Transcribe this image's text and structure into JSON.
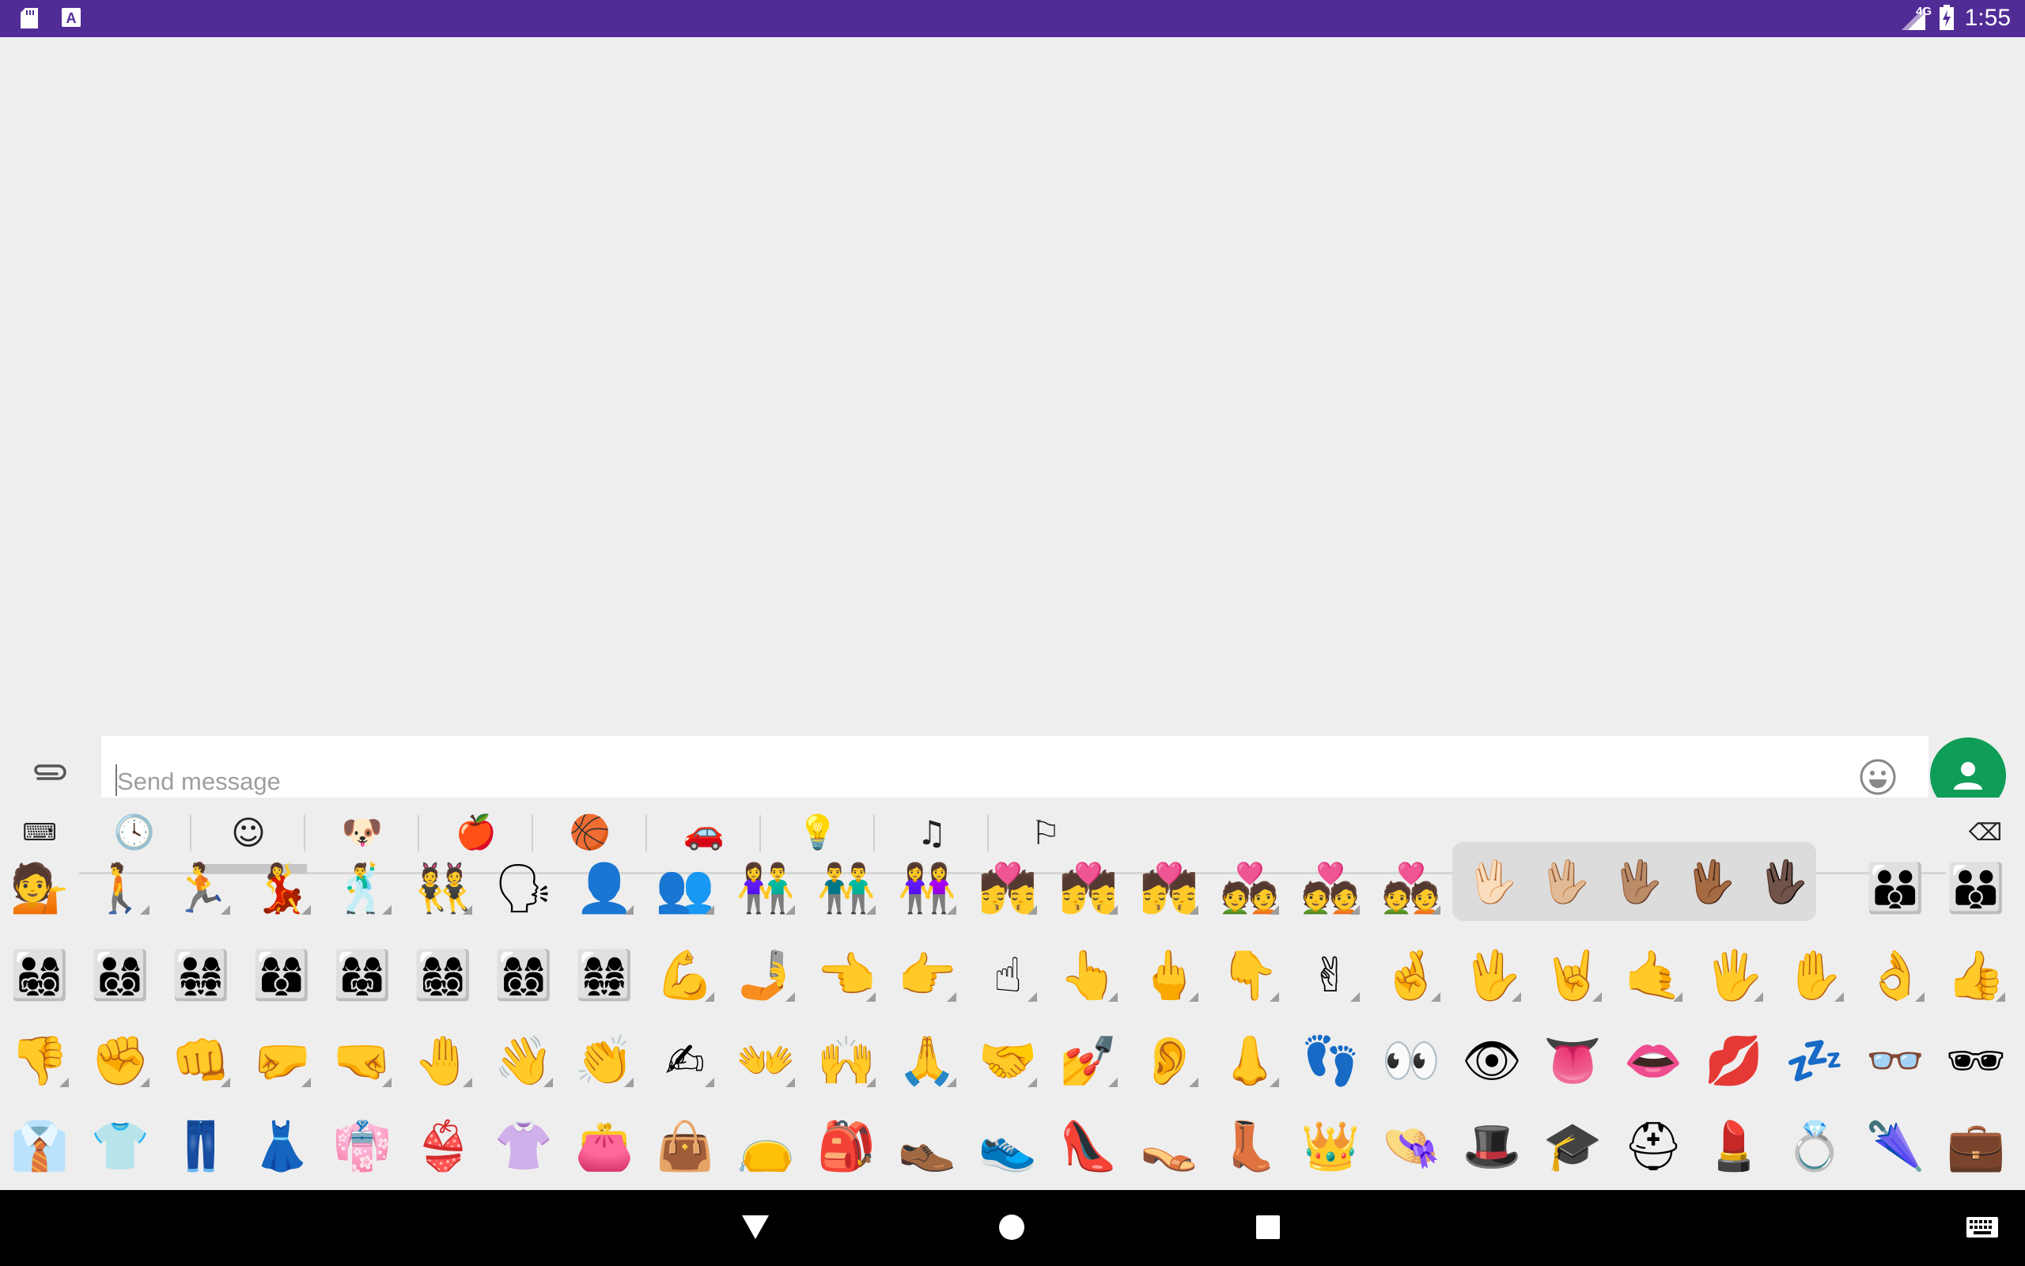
{
  "status_bar": {
    "left_icons": [
      "sd-card-icon",
      "a-notification-icon"
    ],
    "network_label": "4G",
    "time": "1:55",
    "bg_color": "#512c96"
  },
  "compose": {
    "placeholder": "Send message",
    "attach_icon": "paperclip-icon",
    "emoji_icon": "smiley-icon",
    "fab_icon": "person-icon",
    "fab_color": "#0f9d58"
  },
  "emoji_keyboard": {
    "tabs": [
      {
        "name": "keyboard-icon",
        "glyph": "⌨"
      },
      {
        "name": "recent-icon",
        "glyph": "🕓"
      },
      {
        "name": "smileys-icon",
        "glyph": "☺"
      },
      {
        "name": "animals-icon",
        "glyph": "🐶"
      },
      {
        "name": "food-icon",
        "glyph": "🍎"
      },
      {
        "name": "activity-icon",
        "glyph": "🏀"
      },
      {
        "name": "travel-icon",
        "glyph": "🚗"
      },
      {
        "name": "objects-icon",
        "glyph": "💡"
      },
      {
        "name": "symbols-icon",
        "glyph": "♫"
      },
      {
        "name": "flags-icon",
        "glyph": "⚐"
      },
      {
        "name": "backspace-icon",
        "glyph": "⌫"
      }
    ],
    "selected_tab": 2,
    "rows": [
      [
        "💁",
        "🚶",
        "🏃",
        "💃",
        "🕺",
        "👯",
        "🗣",
        "👤",
        "👥",
        "👫",
        "👬",
        "👭",
        "💏",
        "💏",
        "💏",
        "💑",
        "💑",
        "💑",
        "",
        "",
        "",
        "",
        "",
        "👪",
        "👪"
      ],
      [
        "👨‍👩‍👧‍👦",
        "👨‍👩‍👦‍👦",
        "👨‍👩‍👧‍👧",
        "👩‍👩‍👦",
        "👩‍👩‍👧",
        "👩‍👩‍👧‍👦",
        "👩‍👩‍👦‍👦",
        "👩‍👩‍👧‍👧",
        "💪",
        "🤳",
        "👈",
        "👉",
        "☝",
        "👆",
        "🖕",
        "👇",
        "✌",
        "🤞",
        "🖖",
        "🤘",
        "🤙",
        "🖐",
        "✋",
        "👌",
        "👍"
      ],
      [
        "👎",
        "✊",
        "👊",
        "🤛",
        "🤜",
        "🤚",
        "👋",
        "👏",
        "✍",
        "👐",
        "🙌",
        "🙏",
        "🤝",
        "💅",
        "👂",
        "👃",
        "👣",
        "👀",
        "👁",
        "👅",
        "👄",
        "💋",
        "💤",
        "👓",
        "🕶"
      ],
      [
        "👔",
        "👕",
        "👖",
        "👗",
        "👘",
        "👙",
        "👚",
        "👛",
        "👜",
        "👝",
        "🎒",
        "👞",
        "👟",
        "👠",
        "👡",
        "👢",
        "👑",
        "👒",
        "🎩",
        "🎓",
        "⛑",
        "💄",
        "💍",
        "🌂",
        "💼"
      ]
    ],
    "tone_markers": [
      [
        1,
        2,
        3,
        4,
        5,
        7,
        8,
        9,
        10,
        11,
        12,
        13,
        14,
        15,
        16,
        17
      ],
      [
        8,
        9,
        10,
        11,
        12,
        13,
        14,
        15,
        16,
        17,
        18,
        19,
        20,
        21,
        22,
        23,
        24
      ],
      [
        0,
        1,
        2,
        3,
        4,
        5,
        6,
        7,
        8,
        9,
        10,
        11,
        12,
        13,
        14,
        15
      ],
      []
    ],
    "skin_tone_popup": [
      "🖖🏻",
      "🖖🏼",
      "🖖🏽",
      "🖖🏾",
      "🖖🏿"
    ]
  },
  "nav_bar": {
    "buttons": [
      "back-icon",
      "home-icon",
      "recents-icon",
      "keyboard-switch-icon"
    ]
  }
}
